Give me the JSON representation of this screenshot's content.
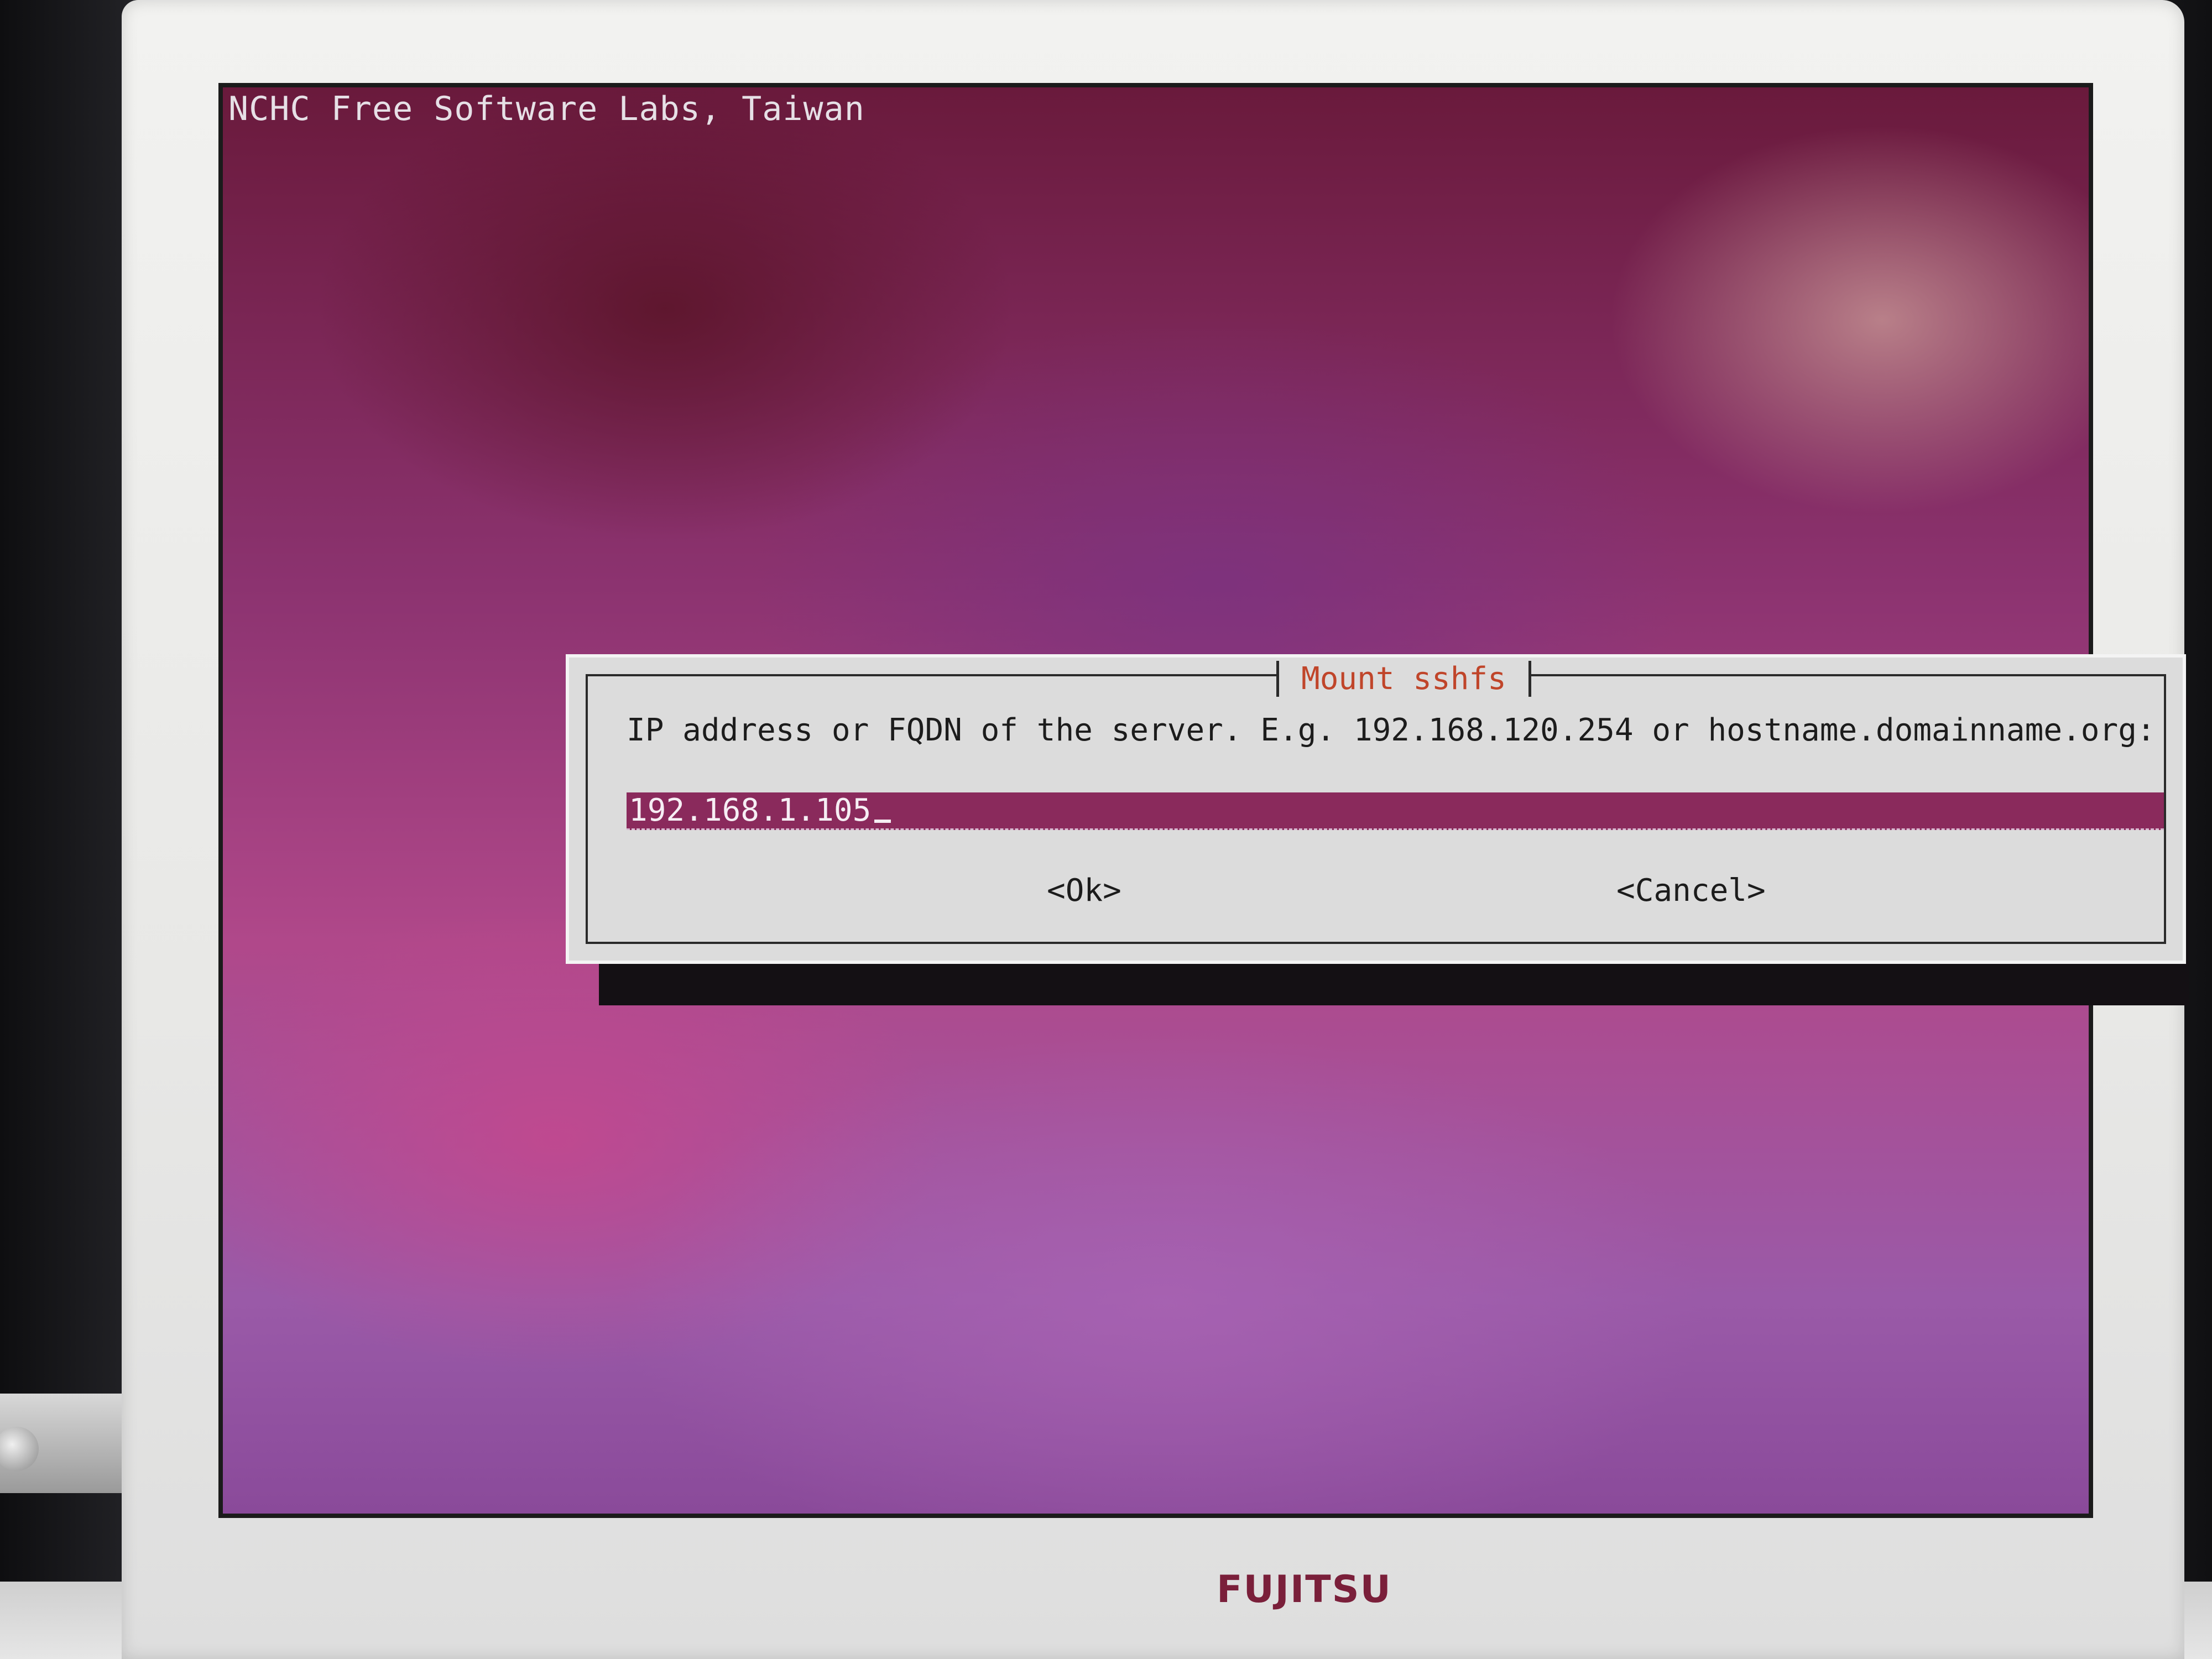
{
  "screen": {
    "header": "NCHC Free Software Labs, Taiwan"
  },
  "dialog": {
    "title": "Mount sshfs",
    "prompt": "IP address or FQDN of the server. E.g. 192.168.120.254 or hostname.domainname.org:",
    "input_value": "192.168.1.105",
    "ok_label": "<Ok>",
    "cancel_label": "<Cancel>"
  },
  "monitor": {
    "brand": "FUJITSU"
  },
  "colors": {
    "dialog_bg": "#dcdcdc",
    "title": "#c0452a",
    "input_bg": "#8a2a5c",
    "screen_bg": "#9a3a7a"
  }
}
